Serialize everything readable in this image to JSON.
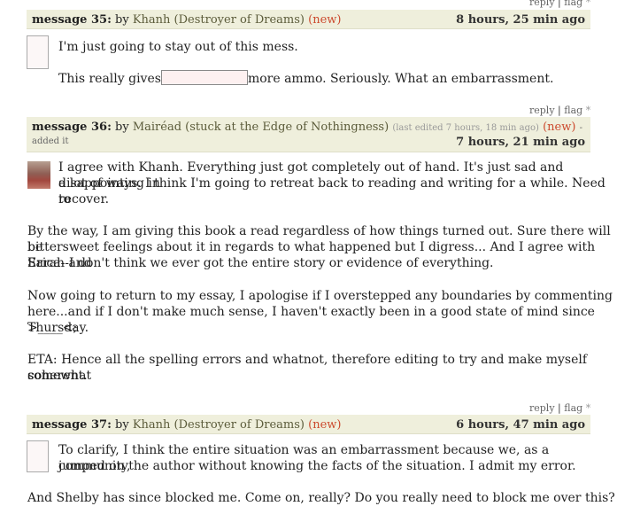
{
  "messages": [
    {
      "actions": {
        "reply": "reply",
        "flag": "flag",
        "flag_mark": "*"
      },
      "number_label": "message 35:",
      "by": "by",
      "author": "Khanh (Destroyer of Dreams)",
      "new_label": "(new)",
      "time": "8 hours, 25 min ago",
      "body": {
        "p1": "I'm just going to stay out of this mess.",
        "p2_before": "This really gives",
        "p2_after": "more ammo. Seriously. What an embarrassment."
      }
    },
    {
      "actions": {
        "reply": "reply",
        "flag": "flag",
        "flag_mark": "*"
      },
      "number_label": "message 36:",
      "by": "by",
      "author": "Mairéad (stuck at the Edge of Nothingness)",
      "last_edited": "(last edited 7 hours, 18 min ago)",
      "new_label": "(new)",
      "added_edit": "- added it",
      "time": "7 hours, 21 min ago",
      "body": {
        "l1": "I agree with Khanh. Everything just got completely out of hand. It's just sad and disappointing in",
        "l2": "a lot of ways. I think I'm going to retreat back to reading and writing for a while. Need to",
        "l3": "recover.",
        "p2l1": "By the way, I am giving this book a read regardless of how things turned out. Sure there will be",
        "p2l2": "bittersweet feelings about it in regards to what happened but I digress... And I agree with Sarah and",
        "p2l3": "Erica--I don't think we ever got the entire story or evidence of everything.",
        "p3l1": "Now going to return to my essay, I apologise if I overstepped any boundaries by commenting",
        "p3l2": "here...and if I don't make much sense, I haven't exactly been in a good state of mind since Thursday.",
        "p3l3": ">____<;",
        "p4l1": "ETA: Hence all the spelling errors and whatnot, therefore editing to try and make myself somewhat",
        "p4l2": "coherent."
      }
    },
    {
      "actions": {
        "reply": "reply",
        "flag": "flag",
        "flag_mark": "*"
      },
      "number_label": "message 37:",
      "by": "by",
      "author": "Khanh (Destroyer of Dreams)",
      "new_label": "(new)",
      "time": "6 hours, 47 min ago",
      "body": {
        "l1": "To clarify, I think the entire situation was an embarrassment because we, as a community,",
        "l2": "jumped on the author without knowing the facts of the situation. I admit my error.",
        "p2": "And Shelby has since blocked me. Come on, really? Do you really need to block me over this?"
      }
    }
  ],
  "colors": {
    "header_bg": "#efefdc",
    "new": "#cc4a2e",
    "text": "#222222"
  }
}
